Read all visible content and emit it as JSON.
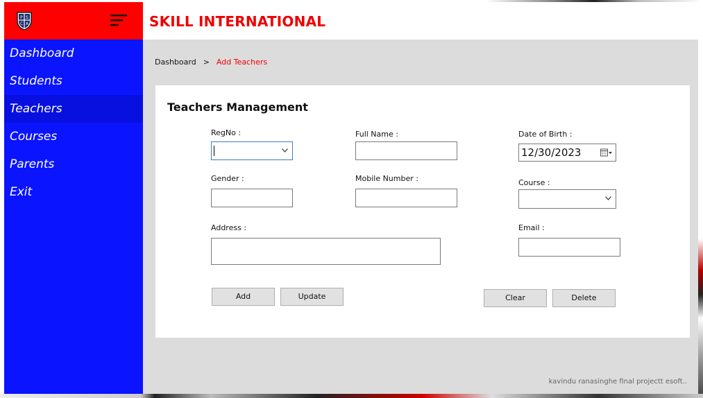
{
  "app": {
    "title": "SKILL INTERNATIONAL",
    "logo_letters": [
      "P",
      "S",
      "C",
      "A"
    ]
  },
  "sidebar": {
    "items": [
      {
        "label": "Dashboard"
      },
      {
        "label": "Students"
      },
      {
        "label": "Teachers",
        "active": true
      },
      {
        "label": "Courses"
      },
      {
        "label": "Parents"
      },
      {
        "label": "Exit"
      }
    ]
  },
  "breadcrumb": {
    "root": "Dashboard",
    "separator": ">",
    "current": "Add Teachers"
  },
  "form": {
    "title": "Teachers Management",
    "regno": {
      "label": "RegNo :",
      "value": ""
    },
    "full_name": {
      "label": "Full Name :",
      "value": ""
    },
    "dob": {
      "label": "Date of Birth :",
      "value": "12/30/2023"
    },
    "gender": {
      "label": "Gender :",
      "value": ""
    },
    "mobile": {
      "label": "Mobile Number :",
      "value": ""
    },
    "course": {
      "label": "Course :",
      "value": ""
    },
    "address": {
      "label": "Address :",
      "value": ""
    },
    "email": {
      "label": "Email :",
      "value": ""
    }
  },
  "buttons": {
    "add": "Add",
    "update": "Update",
    "clear": "Clear",
    "delete": "Delete"
  },
  "footer": {
    "note": "kavindu ranasinghe final projectt esoft.."
  },
  "colors": {
    "sidebar": "#0a14ff",
    "accent_red": "#ff0000",
    "title_red": "#ee0000",
    "content_bg": "#dcdcdc"
  },
  "icons": [
    "logo-icon",
    "hamburger-menu-icon",
    "chevron-down-icon",
    "calendar-icon"
  ]
}
